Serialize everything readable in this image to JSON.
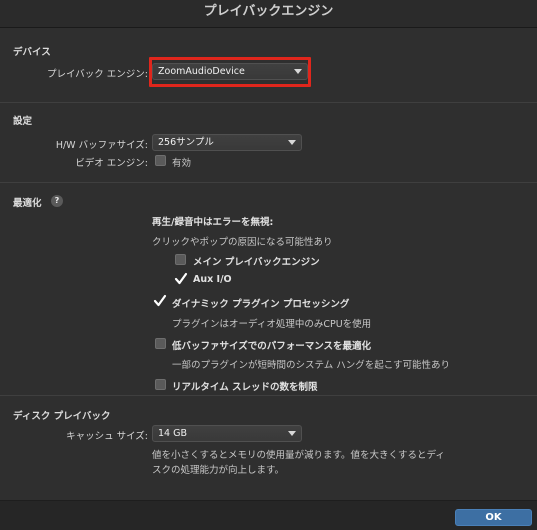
{
  "window": {
    "title": "プレイバックエンジン"
  },
  "device": {
    "section_title": "デバイス",
    "playback_engine_label": "プレイバック エンジン:",
    "playback_engine_value": "ZoomAudioDevice"
  },
  "settings": {
    "section_title": "設定",
    "buffer_size_label": "H/W バッファサイズ:",
    "buffer_size_value": "256サンプル",
    "video_engine_label": "ビデオ エンジン:",
    "video_engine_checkbox_label": "有効",
    "video_engine_checked": false
  },
  "optimization": {
    "section_title": "最適化",
    "help_glyph": "?",
    "ignore_errors_heading": "再生/録音中はエラーを無視:",
    "ignore_errors_desc": "クリックやポップの原因になる可能性あり",
    "main_playback_engine_label": "メイン プレイバックエンジン",
    "main_playback_engine_checked": false,
    "aux_io_label": "Aux I/O",
    "aux_io_checked": true,
    "dynamic_plugin_label": "ダイナミック プラグイン プロセッシング",
    "dynamic_plugin_checked": true,
    "dynamic_plugin_desc": "プラグインはオーディオ処理中のみCPUを使用",
    "low_buffer_label": "低バッファサイズでのパフォーマンスを最適化",
    "low_buffer_checked": false,
    "low_buffer_desc": "一部のプラグインが短時間のシステム ハングを起こす可能性あり",
    "limit_threads_label": "リアルタイム スレッドの数を制限",
    "limit_threads_checked": false
  },
  "disk_playback": {
    "section_title": "ディスク プレイバック",
    "cache_size_label": "キャッシュ サイズ:",
    "cache_size_value": "14 GB",
    "cache_desc_line1": "値を小さくするとメモリの使用量が減ります。値を大きくするとディ",
    "cache_desc_line2": "スクの処理能力が向上します。"
  },
  "footer": {
    "ok_label": "OK"
  },
  "colors": {
    "highlight": "#e0261c",
    "accent": "#3d6fa3",
    "checkmark": "#ffffff"
  }
}
